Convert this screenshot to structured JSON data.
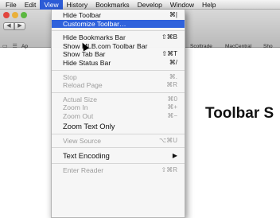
{
  "menubar": {
    "items": [
      "File",
      "Edit",
      "View",
      "History",
      "Bookmarks",
      "Develop",
      "Window",
      "Help"
    ]
  },
  "toolbar": {
    "back_glyph": "◀",
    "forward_glyph": "▶"
  },
  "bookmarks_bar": {
    "icons": "▭ ☰",
    "partial_label": "Ap",
    "links": [
      "Scottrade",
      "MacCentral",
      "Sho"
    ]
  },
  "view_menu": {
    "hide_toolbar": "Hide Toolbar",
    "hide_toolbar_sc": "⌘|",
    "customize_toolbar": "Customize Toolbar…",
    "hide_bookmarks_bar": "Hide Bookmarks Bar",
    "hide_bookmarks_bar_sc": "⇧⌘B",
    "show_mlb_toolbar": "Show MLB.com Toolbar Bar",
    "show_tab_bar": "Show Tab Bar",
    "show_tab_bar_sc": "⇧⌘T",
    "hide_status_bar": "Hide Status Bar",
    "hide_status_bar_sc": "⌘/",
    "stop": "Stop",
    "stop_sc": "⌘.",
    "reload_page": "Reload Page",
    "reload_page_sc": "⌘R",
    "actual_size": "Actual Size",
    "actual_size_sc": "⌘0",
    "zoom_in": "Zoom In",
    "zoom_in_sc": "⌘+",
    "zoom_out": "Zoom Out",
    "zoom_out_sc": "⌘−",
    "zoom_text_only": "Zoom Text Only",
    "view_source": "View Source",
    "view_source_sc": "⌥⌘U",
    "text_encoding": "Text Encoding",
    "text_encoding_sc": "▶",
    "enter_reader": "Enter Reader",
    "enter_reader_sc": "⇧⌘R"
  },
  "page": {
    "label": "Toolbar S"
  }
}
